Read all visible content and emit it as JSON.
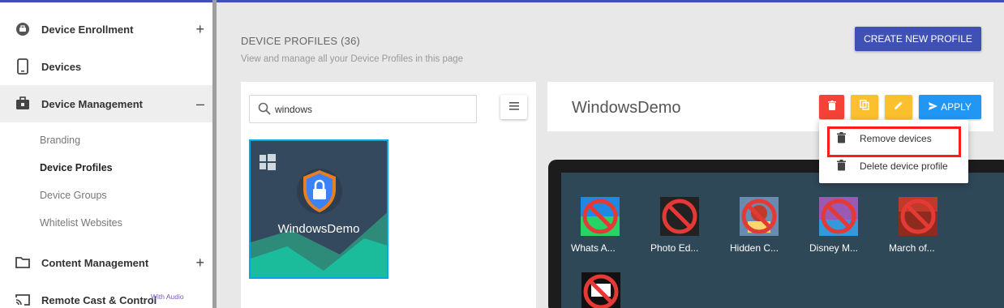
{
  "sidebar": {
    "items": [
      {
        "label": "Device Enrollment",
        "icon": "enrollment-icon",
        "toggle": "+"
      },
      {
        "label": "Devices",
        "icon": "phone-icon"
      },
      {
        "label": "Device Management",
        "icon": "briefcase-icon",
        "toggle": "–"
      },
      {
        "label": "Content Management",
        "icon": "folder-icon",
        "toggle": "+"
      },
      {
        "label": "Remote Cast & Control",
        "icon": "cast-icon",
        "badge": "With Audio"
      }
    ],
    "subitems": [
      "Branding",
      "Device Profiles",
      "Device Groups",
      "Whitelist Websites"
    ],
    "current_subitem": "Device Profiles"
  },
  "header": {
    "title": "DEVICE PROFILES (36)",
    "subtitle": "View and manage all your Device Profiles in this page",
    "create_button": "CREATE NEW PROFILE"
  },
  "search": {
    "value": "windows"
  },
  "profiles": [
    {
      "name": "WindowsDemo",
      "platform": "windows-icon"
    }
  ],
  "detail": {
    "profile_name": "WindowsDemo",
    "apply_label": "APPLY",
    "menu": [
      "Remove devices",
      "Delete device profile"
    ]
  },
  "apps": [
    {
      "label": "Whats A...",
      "color": "#25d366"
    },
    {
      "label": "Photo Ed...",
      "color": "#222222"
    },
    {
      "label": "Hidden C...",
      "color": "#6a8bb0"
    },
    {
      "label": "Disney M...",
      "color": "#9b59b6"
    },
    {
      "label": "March of...",
      "color": "#c0392b"
    },
    {
      "label": "",
      "color": "#111111"
    }
  ],
  "colors": {
    "accent": "#3f51b5",
    "danger": "#f44336",
    "warning": "#fbc02d",
    "primary": "#2196f3",
    "highlight": "#ff1c1c"
  }
}
